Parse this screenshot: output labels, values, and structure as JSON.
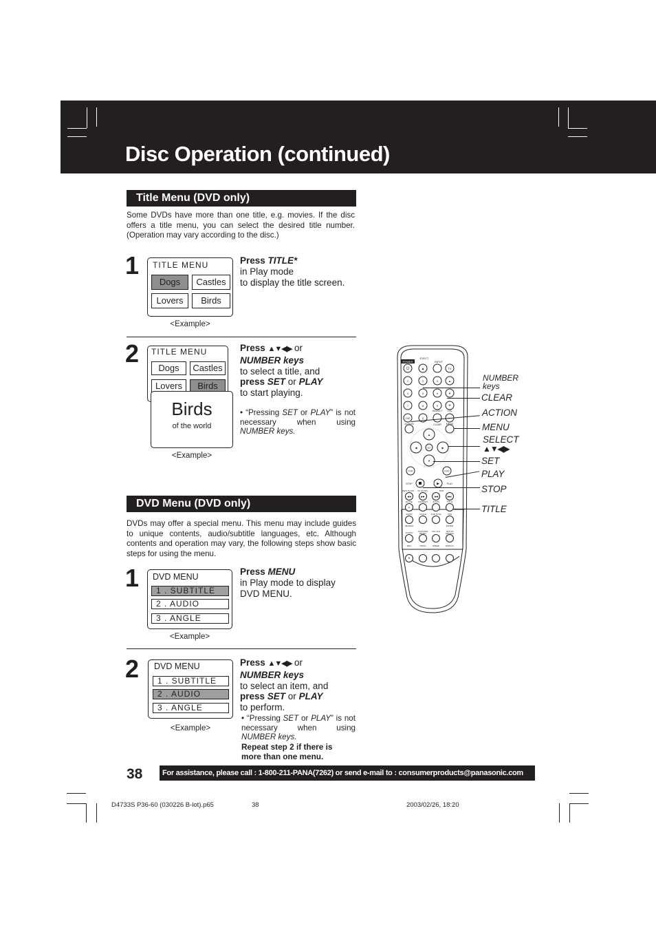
{
  "header": {
    "title": "Disc Operation (continued)"
  },
  "title_menu_section": {
    "heading": "Title Menu (DVD only)",
    "intro": "Some DVDs have more than one title, e.g. movies. If the disc offers a title menu, you can select the desired title number. (Operation may vary according to the disc.)",
    "step1": {
      "number": "1",
      "screen_title": "TITLE  MENU",
      "cells": [
        "Dogs",
        "Castles",
        "Lovers",
        "Birds"
      ],
      "selected": "Dogs",
      "example_label": "<Example>",
      "instr_press": "Press ",
      "instr_key": "TITLE*",
      "instr_line2": "in Play mode",
      "instr_line3": "to display the title screen."
    },
    "step2": {
      "number": "2",
      "screen_title": "TITLE  MENU",
      "cells": [
        "Dogs",
        "Castles",
        "Lovers",
        "Birds"
      ],
      "selected": "Birds",
      "popup_title": "Birds",
      "popup_subtitle": "of  the  world",
      "example_label": "<Example>",
      "instr_press": "Press ",
      "instr_arrows": "▲▼◀▶",
      "instr_or": " or",
      "instr_number_keys": "NUMBER keys",
      "instr_line3": "to select a title, and",
      "instr_press2": "press ",
      "instr_set": "SET",
      "instr_or2": " or ",
      "instr_play": "PLAY",
      "instr_line5": "to start playing.",
      "note_prefix": "• “Pressing ",
      "note_set": "SET",
      "note_or": " or ",
      "note_play": "PLAY",
      "note_mid": "” is not necessary when using ",
      "note_keys": "NUMBER keys."
    }
  },
  "dvd_menu_section": {
    "heading": "DVD Menu (DVD only)",
    "intro": "DVDs may offer a special menu. This menu may include guides to unique contents, audio/subtitle languages, etc. Although contents and operation may vary, the following steps show basic steps for using the menu.",
    "step1": {
      "number": "1",
      "screen_title": "DVD MENU",
      "items": [
        "1 . SUBTITLE",
        "2 . AUDIO",
        "3 . ANGLE"
      ],
      "selected_index": 0,
      "example_label": "<Example>",
      "instr_press": "Press ",
      "instr_key": "MENU",
      "instr_line2": "in Play mode to display",
      "instr_line3": "DVD MENU."
    },
    "step2": {
      "number": "2",
      "screen_title": "DVD MENU",
      "items": [
        "1 . SUBTITLE",
        "2 . AUDIO",
        "3 . ANGLE"
      ],
      "selected_index": 1,
      "example_label": "<Example>",
      "instr_press": "Press ",
      "instr_arrows": "▲▼◀▶",
      "instr_or": " or",
      "instr_number_keys": "NUMBER keys",
      "instr_line3": "to select an item, and",
      "instr_press2": "press ",
      "instr_set": "SET",
      "instr_or2": " or ",
      "instr_play": "PLAY",
      "instr_line5": "to perform.",
      "note_prefix": "• “Pressing ",
      "note_set": "SET",
      "note_or": " or ",
      "note_play": "PLAY",
      "note_mid": "” is not necessary when using ",
      "note_keys": "NUMBER keys.",
      "repeat_note": "Repeat step 2 if there is more than one menu."
    }
  },
  "remote": {
    "top_labels": [
      "POWER",
      "EJECT",
      "INPUT",
      "TV"
    ],
    "number_buttons": [
      "1",
      "2",
      "3",
      "4",
      "5",
      "6",
      "7",
      "8",
      "9",
      "100",
      "0"
    ],
    "small_labels": {
      "add_dlt": "ADD/DLT",
      "vol": "VOL",
      "clear": "CLEAR",
      "menu": "MENU",
      "action": "ACTION",
      "set": "SET",
      "vcr": "VCR",
      "dvd": "DVD",
      "stop": "STOP",
      "play": "PLAY",
      "rew": "REW SLOW-",
      "ff": "FF SLOW+",
      "skip": "SKIP",
      "pause": "PAUSE",
      "cm_zero": "CM/ZERO",
      "zoom": "ZOOM",
      "title": "TITLE",
      "still": "STILL",
      "audio": "AUDIO",
      "angle": "ANGLE",
      "sub_title": "SUB TITLE",
      "vss": "VSS",
      "search": "SEARCH",
      "enter": "ENTER",
      "vcr_tv": "VCR/TV",
      "counter_reset": "COUNTER RESET",
      "vol_adj": "VOL ADJ",
      "setup_search": "SETUP/ SEARCH",
      "rec": "REC",
      "prog": "PROG",
      "speed": "SPEED",
      "display": "DISPLAY"
    },
    "callouts": [
      {
        "label": "NUMBER\nkeys"
      },
      {
        "label": "CLEAR"
      },
      {
        "label": "ACTION"
      },
      {
        "label": "MENU"
      },
      {
        "label": "SELECT"
      },
      {
        "label": "SET"
      },
      {
        "label": "PLAY"
      },
      {
        "label": "STOP"
      },
      {
        "label": "TITLE"
      }
    ],
    "select_arrows": "▲▼◀▶"
  },
  "footer": {
    "page_number": "38",
    "assistance": "For assistance, please call : 1-800-211-PANA(7262) or send e-mail to : consumerproducts@panasonic.com",
    "slug_file": "D4733S P36-60 (030226 B-lot).p65",
    "slug_page": "38",
    "slug_date": "2003/02/26, 18:20"
  }
}
